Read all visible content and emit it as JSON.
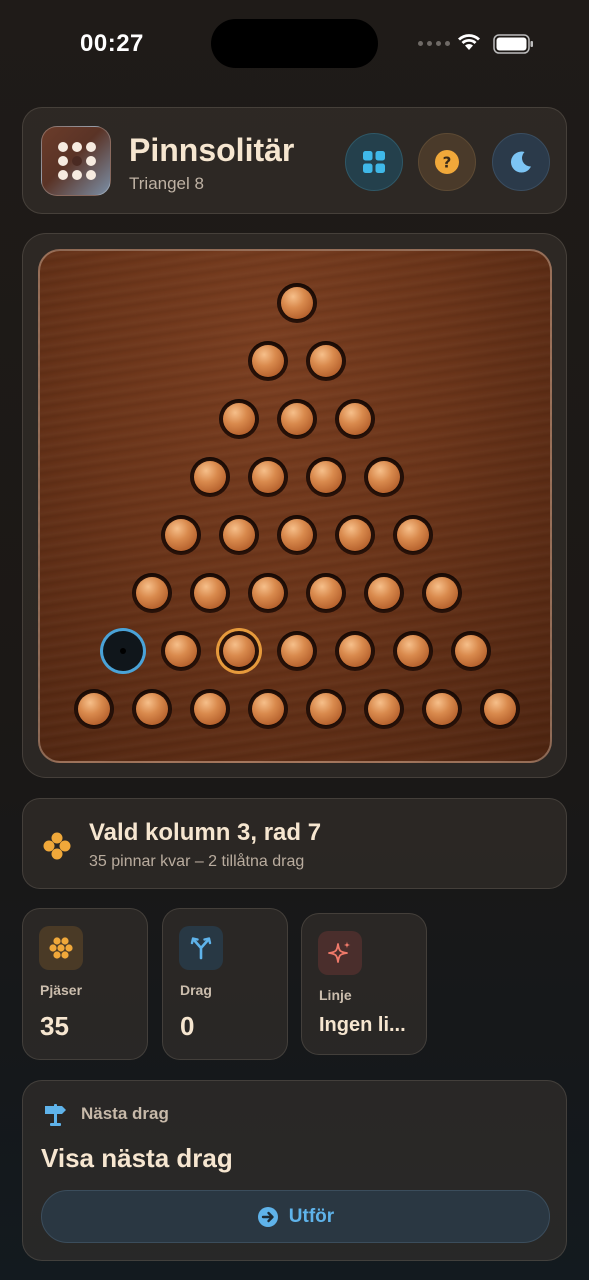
{
  "status_bar": {
    "time": "00:27"
  },
  "header": {
    "app_title": "Pinnsolitär",
    "subtitle": "Triangel 8",
    "buttons": [
      {
        "name": "grid-button",
        "icon": "grid-icon",
        "color": "#3fb8e8"
      },
      {
        "name": "help-button",
        "icon": "question-icon",
        "color": "#f0a83a"
      },
      {
        "name": "theme-button",
        "icon": "moon-icon",
        "color": "#7cc4f4"
      }
    ]
  },
  "board": {
    "rows": 8,
    "pegs": [
      [
        1
      ],
      [
        1,
        1
      ],
      [
        1,
        1,
        1
      ],
      [
        1,
        1,
        1,
        1
      ],
      [
        1,
        1,
        1,
        1,
        1
      ],
      [
        1,
        1,
        1,
        1,
        1,
        1
      ],
      [
        0,
        1,
        1,
        1,
        1,
        1,
        1
      ],
      [
        1,
        1,
        1,
        1,
        1,
        1,
        1,
        1
      ]
    ],
    "selected": {
      "row": 7,
      "col": 3
    },
    "target": {
      "row": 7,
      "col": 1
    }
  },
  "info": {
    "title": "Vald kolumn 3, rad 7",
    "subtitle": "35 pinnar kvar – 2 tillåtna drag"
  },
  "stats": [
    {
      "label": "Pjäser",
      "value": "35",
      "icon": "honeycomb-icon"
    },
    {
      "label": "Drag",
      "value": "0",
      "icon": "merge-arrow-icon"
    },
    {
      "label": "Linje",
      "value": "Ingen li...",
      "icon": "sparkles-icon"
    }
  ],
  "next_move": {
    "label": "Nästa drag",
    "title": "Visa nästa drag",
    "button_label": "Utför"
  },
  "colors": {
    "accent_orange": "#f0a83a",
    "accent_blue": "#5fb3ea",
    "peg": "#d98a4d",
    "board": "#6a3419"
  }
}
